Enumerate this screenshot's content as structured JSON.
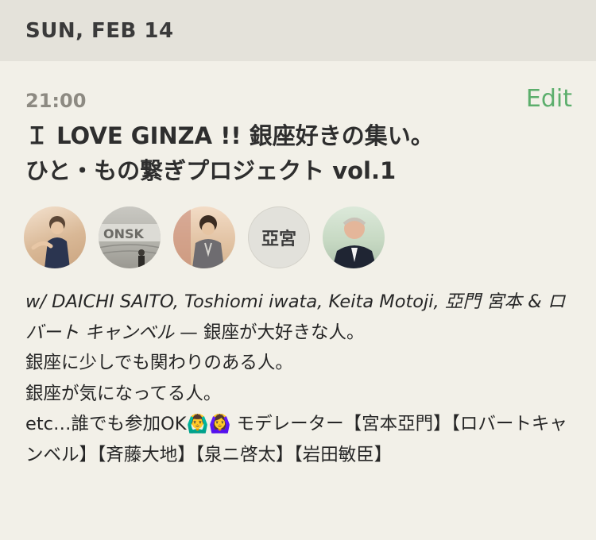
{
  "date_header": "SUN, FEB 14",
  "event": {
    "time": "21:00",
    "edit_label": "Edit",
    "title_line1": "Ｉ LOVE GINZA !! 銀座好きの集い。",
    "title_line2": "ひと・もの繋ぎプロジェクト vol.1",
    "avatars": [
      {
        "type": "photo"
      },
      {
        "type": "photo"
      },
      {
        "type": "photo"
      },
      {
        "type": "initials",
        "text": "亞宮"
      },
      {
        "type": "photo"
      }
    ],
    "description": {
      "with_prefix": "w/ DAICHI SAITO, Toshiomi iwata, Keita Motoji, 亞門 宮本 & ロバート キャンベル",
      "line1_rest": " — 銀座が大好きな人。",
      "line2": "銀座に少しでも関わりのある人。",
      "line3": "銀座が気になってる人。",
      "line4": "etc…誰でも参加OK🙆‍♂️🙆‍♀️ モデレーター【宮本亞門】【ロバートキャンベル】【斉藤大地】【泉ニ啓太】【岩田敏臣】"
    }
  },
  "colors": {
    "background": "#f2f0e8",
    "header_background": "#e4e2da",
    "edit_accent": "#5cae6c",
    "time_gray": "#8d8a82"
  }
}
